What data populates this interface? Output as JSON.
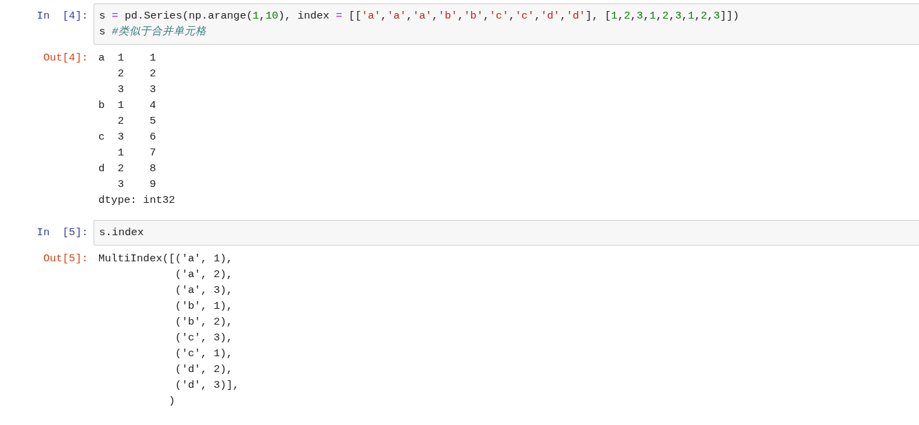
{
  "cells": [
    {
      "prompt_in": "In  [4]:",
      "code": [
        [
          {
            "kind": "plain",
            "text": "s "
          },
          {
            "kind": "op",
            "text": "="
          },
          {
            "kind": "plain",
            "text": " pd.Series(np.arange("
          },
          {
            "kind": "num",
            "text": "1"
          },
          {
            "kind": "plain",
            "text": ","
          },
          {
            "kind": "num",
            "text": "10"
          },
          {
            "kind": "plain",
            "text": "), index "
          },
          {
            "kind": "op",
            "text": "="
          },
          {
            "kind": "plain",
            "text": " [["
          },
          {
            "kind": "str",
            "text": "'a'"
          },
          {
            "kind": "plain",
            "text": ","
          },
          {
            "kind": "str",
            "text": "'a'"
          },
          {
            "kind": "plain",
            "text": ","
          },
          {
            "kind": "str",
            "text": "'a'"
          },
          {
            "kind": "plain",
            "text": ","
          },
          {
            "kind": "str",
            "text": "'b'"
          },
          {
            "kind": "plain",
            "text": ","
          },
          {
            "kind": "str",
            "text": "'b'"
          },
          {
            "kind": "plain",
            "text": ","
          },
          {
            "kind": "str",
            "text": "'c'"
          },
          {
            "kind": "plain",
            "text": ","
          },
          {
            "kind": "str",
            "text": "'c'"
          },
          {
            "kind": "plain",
            "text": ","
          },
          {
            "kind": "str",
            "text": "'d'"
          },
          {
            "kind": "plain",
            "text": ","
          },
          {
            "kind": "str",
            "text": "'d'"
          },
          {
            "kind": "plain",
            "text": "], ["
          },
          {
            "kind": "num",
            "text": "1"
          },
          {
            "kind": "plain",
            "text": ","
          },
          {
            "kind": "num",
            "text": "2"
          },
          {
            "kind": "plain",
            "text": ","
          },
          {
            "kind": "num",
            "text": "3"
          },
          {
            "kind": "plain",
            "text": ","
          },
          {
            "kind": "num",
            "text": "1"
          },
          {
            "kind": "plain",
            "text": ","
          },
          {
            "kind": "num",
            "text": "2"
          },
          {
            "kind": "plain",
            "text": ","
          },
          {
            "kind": "num",
            "text": "3"
          },
          {
            "kind": "plain",
            "text": ","
          },
          {
            "kind": "num",
            "text": "1"
          },
          {
            "kind": "plain",
            "text": ","
          },
          {
            "kind": "num",
            "text": "2"
          },
          {
            "kind": "plain",
            "text": ","
          },
          {
            "kind": "num",
            "text": "3"
          },
          {
            "kind": "plain",
            "text": "]])"
          }
        ],
        [
          {
            "kind": "plain",
            "text": "s "
          },
          {
            "kind": "comment",
            "text": "#类似于合并单元格"
          }
        ]
      ],
      "prompt_out": "Out[4]:",
      "output": [
        "a  1    1",
        "   2    2",
        "   3    3",
        "b  1    4",
        "   2    5",
        "c  3    6",
        "   1    7",
        "d  2    8",
        "   3    9",
        "dtype: int32"
      ]
    },
    {
      "prompt_in": "In  [5]:",
      "code": [
        [
          {
            "kind": "plain",
            "text": "s.index"
          }
        ]
      ],
      "prompt_out": "Out[5]:",
      "output": [
        "MultiIndex([('a', 1),",
        "            ('a', 2),",
        "            ('a', 3),",
        "            ('b', 1),",
        "            ('b', 2),",
        "            ('c', 3),",
        "            ('c', 1),",
        "            ('d', 2),",
        "            ('d', 3)],",
        "           )"
      ]
    }
  ]
}
